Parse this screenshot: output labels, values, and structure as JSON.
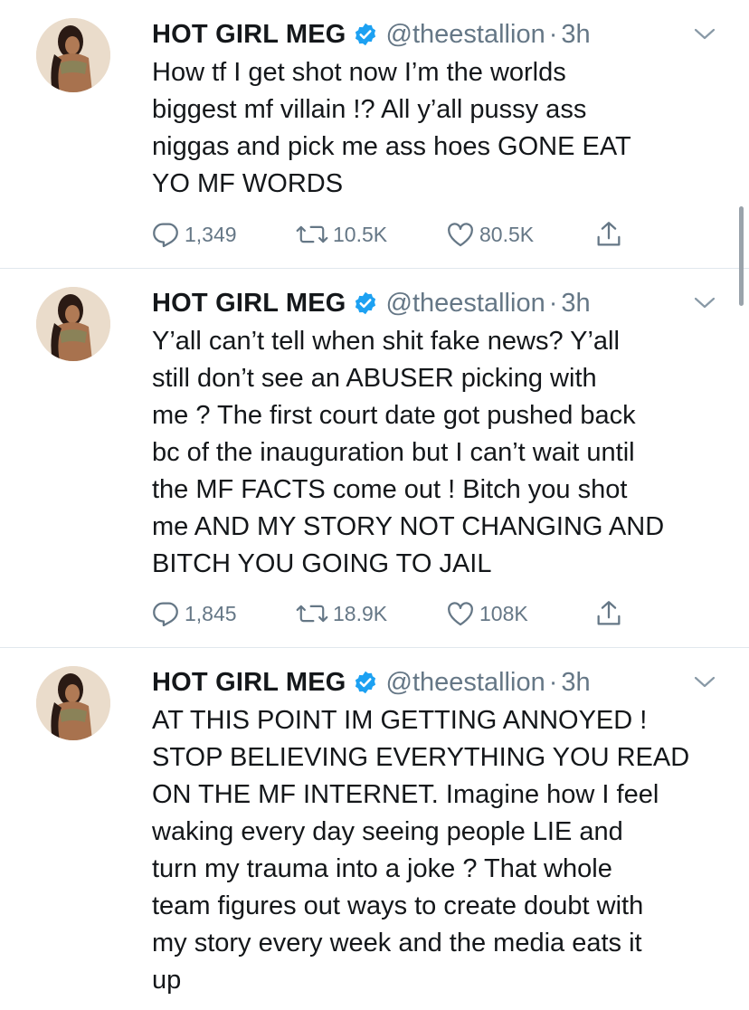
{
  "tweets": [
    {
      "display_name": "HOT GIRL MEG",
      "handle": "@theestallion",
      "separator": "·",
      "time": "3h",
      "text": "How tf I get shot now I’m the worlds\nbiggest mf villain !? All y’all pussy ass\nniggas and pick me ass hoes GONE EAT\nYO MF WORDS",
      "replies": "1,349",
      "retweets": "10.5K",
      "likes": "80.5K"
    },
    {
      "display_name": "HOT GIRL MEG",
      "handle": "@theestallion",
      "separator": "·",
      "time": "3h",
      "text": "Y’all can’t tell when shit fake news? Y’all\nstill don’t see an ABUSER picking with\nme ? The first court date got pushed back\nbc of the inauguration but I can’t wait until\nthe MF FACTS come out ! Bitch you shot\nme AND MY STORY NOT CHANGING AND\nBITCH YOU GOING TO JAIL",
      "replies": "1,845",
      "retweets": "18.9K",
      "likes": "108K"
    },
    {
      "display_name": "HOT GIRL MEG",
      "handle": "@theestallion",
      "separator": "·",
      "time": "3h",
      "text": "AT THIS POINT IM GETTING ANNOYED !\nSTOP BELIEVING EVERYTHING YOU READ\nON THE MF INTERNET. Imagine how I feel\nwaking every day seeing people LIE and\nturn my trauma into a joke ? That whole\nteam figures out ways to create doubt with\nmy story every week and the media eats it\nup"
    }
  ],
  "icons": {
    "verified": "verified-badge-icon",
    "caret": "chevron-down-icon",
    "reply": "reply-icon",
    "retweet": "retweet-icon",
    "like": "heart-icon",
    "share": "share-icon"
  },
  "colors": {
    "verified_blue": "#1da1f2",
    "text_primary": "#14171a",
    "text_secondary": "#657786",
    "divider": "#e1e8ed"
  }
}
